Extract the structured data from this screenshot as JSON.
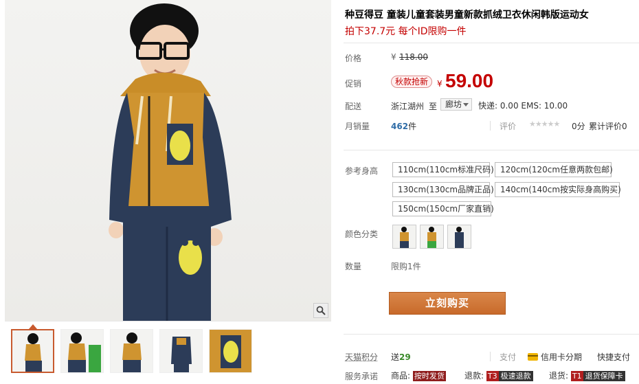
{
  "product": {
    "title": "种豆得豆 童装儿童套装男童新款抓绒卫衣休闲韩版运动女",
    "subtitle": "拍下37.7元 每个ID限购一件"
  },
  "price": {
    "label": "价格",
    "currency": "¥",
    "original": "118.00"
  },
  "promo": {
    "label": "促销",
    "tag": "秋款抢新",
    "currency": "¥",
    "price": "59.00"
  },
  "shipping": {
    "label": "配送",
    "from": "浙江湖州",
    "to_word": "至",
    "destination": "廊坊",
    "fees": "快递: 0.00 EMS: 10.00"
  },
  "sales": {
    "label": "月销量",
    "count": "462",
    "unit": "件",
    "rating_label": "评价",
    "score": "0分",
    "total_reviews": "累计评价0"
  },
  "sizes": {
    "label": "参考身高",
    "options": [
      "110cm(110cm标准尺码)",
      "120cm(120cm任意两款包邮)",
      "130cm(130cm品牌正品)",
      "140cm(140cm按实际身高购买)",
      "150cm(150cm厂家直销)"
    ]
  },
  "colors": {
    "label": "颜色分类",
    "swatches": [
      "orange-navy",
      "green",
      "orange-navy-2"
    ]
  },
  "quantity": {
    "label": "数量",
    "limit": "限购1件"
  },
  "buy_button": "立刻购买",
  "tmall_points": {
    "label": "天猫积分",
    "text_prefix": "送",
    "value": "29"
  },
  "payment": {
    "label": "支付",
    "credit": "信用卡分期",
    "express": "快捷支付"
  },
  "service": {
    "label": "服务承诺",
    "goods_label": "商品:",
    "goods_tag": "按时发货",
    "refund_label": "退款:",
    "refund_code": "T3",
    "refund_tag": "极速退款",
    "return_label": "退货:",
    "return_code": "T1",
    "return_tag": "退货保障卡"
  },
  "icons": {
    "zoom": "magnifier-icon",
    "dropdown": "chevron-down-icon",
    "credit_card": "credit-card-icon"
  },
  "colors_theme": {
    "price_red": "#c40000",
    "buy_orange": "#c86a2a",
    "link_blue": "#2e6ca6"
  }
}
